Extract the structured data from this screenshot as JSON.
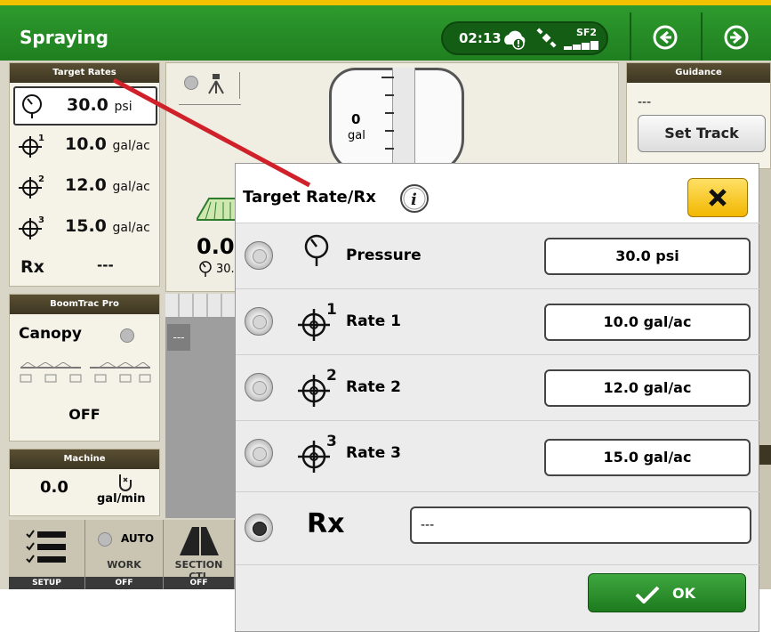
{
  "header": {
    "title": "Spraying",
    "clock": "02:13",
    "sf_label": "SF2",
    "back_icon": "arrow-left-circle-icon",
    "forward_icon": "arrow-right-circle-icon"
  },
  "target_rates": {
    "title": "Target Rates",
    "rows": [
      {
        "icon": "pressure-gauge-icon",
        "value": "30.0",
        "unit": "psi"
      },
      {
        "icon": "target-1-icon",
        "index": "1",
        "value": "10.0",
        "unit": "gal/ac"
      },
      {
        "icon": "target-2-icon",
        "index": "2",
        "value": "12.0",
        "unit": "gal/ac"
      },
      {
        "icon": "target-3-icon",
        "index": "3",
        "value": "15.0",
        "unit": "gal/ac"
      }
    ],
    "rx_label": "Rx",
    "rx_value": "---"
  },
  "boomtrac": {
    "title": "BoomTrac Pro",
    "mode": "Canopy",
    "state": "OFF"
  },
  "machine": {
    "title": "Machine",
    "value": "0.0",
    "unit": "gal/min"
  },
  "center": {
    "tank_value": "0",
    "tank_unit": "gal",
    "rate_value": "0.0",
    "pressure_value": "30.",
    "field_text": "---"
  },
  "guidance": {
    "title": "Guidance",
    "value": "---",
    "set_track_label": "Set Track"
  },
  "toolbar": {
    "setup_label": "SETUP",
    "work_auto": "AUTO",
    "work_label": "WORK",
    "work_status": "OFF",
    "section_label": "SECTION CTL",
    "section_status": "OFF"
  },
  "dialog": {
    "title": "Target Rate/Rx",
    "rows": [
      {
        "label": "Pressure",
        "value": "30.0 psi",
        "selected": false
      },
      {
        "label": "Rate 1",
        "index": "1",
        "value": "10.0 gal/ac",
        "selected": false
      },
      {
        "label": "Rate 2",
        "index": "2",
        "value": "12.0 gal/ac",
        "selected": false
      },
      {
        "label": "Rate 3",
        "index": "3",
        "value": "15.0 gal/ac",
        "selected": false
      }
    ],
    "rx_label": "Rx",
    "rx_value": "---",
    "ok_label": "OK"
  },
  "colors": {
    "header_green": "#2e9b2e",
    "header_accent_yellow": "#f2c200",
    "close_yellow": "#f2b700",
    "ok_green": "#1d7a1d",
    "pointer_red": "#d0212a"
  }
}
